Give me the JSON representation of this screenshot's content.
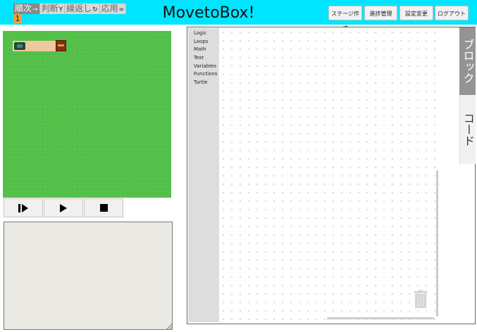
{
  "header": {
    "category_tabs": [
      {
        "label": "順次",
        "symbol": "→",
        "active": true
      },
      {
        "label": "判断",
        "symbol": "Y"
      },
      {
        "label": "繰返し",
        "symbol": "↻"
      },
      {
        "label": "応用",
        "symbol": "∞"
      }
    ],
    "stage_number": "1",
    "title": "MovetoBox!",
    "buttons": {
      "create_stage": "ステージ作成",
      "progress": "進捗管理",
      "settings": "設定変更",
      "logout": "ログアウト"
    }
  },
  "controls": {
    "step": "step-forward-icon",
    "run": "play-icon",
    "stop": "stop-icon"
  },
  "toolbox": {
    "categories": [
      "Logic",
      "Loops",
      "Math",
      "Text",
      "Variables",
      "Functions",
      "Turtle"
    ]
  },
  "side_tabs": {
    "block": "ブロック",
    "code": "コード"
  },
  "colors": {
    "header_bg": "#00e5ff",
    "stage_grass": "#55c04a",
    "path": "#f0c8a0",
    "stage_badge": "#e8a040",
    "active_side_tab": "#949494"
  }
}
